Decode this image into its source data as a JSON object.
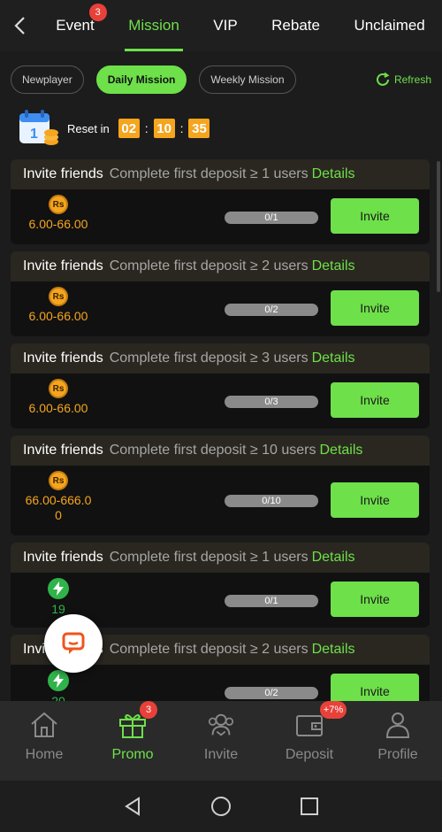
{
  "topnav": {
    "tabs": [
      {
        "label": "Event",
        "badge": "3"
      },
      {
        "label": "Mission"
      },
      {
        "label": "VIP"
      },
      {
        "label": "Rebate"
      },
      {
        "label": "Unclaimed"
      }
    ],
    "active": "Mission"
  },
  "filters": {
    "items": [
      "Newplayer",
      "Daily Mission",
      "Weekly Mission"
    ],
    "active": "Daily Mission",
    "refresh_label": "Refresh"
  },
  "reset": {
    "label": "Reset in",
    "hours": "02",
    "minutes": "10",
    "seconds": "35",
    "sep": ":"
  },
  "tasks": [
    {
      "title": "Invite friends",
      "desc": "Complete first deposit ≥ 1 users",
      "details": "Details",
      "reward_icon": "rs-coin-icon",
      "coin_text": "Rs",
      "amount": "6.00-66.00",
      "progress": "0/1",
      "button": "Invite"
    },
    {
      "title": "Invite friends",
      "desc": "Complete first deposit ≥ 2 users",
      "details": "Details",
      "reward_icon": "rs-coin-icon",
      "coin_text": "Rs",
      "amount": "6.00-66.00",
      "progress": "0/2",
      "button": "Invite"
    },
    {
      "title": "Invite friends",
      "desc": "Complete first deposit ≥ 3 users",
      "details": "Details",
      "reward_icon": "rs-coin-icon",
      "coin_text": "Rs",
      "amount": "6.00-66.00",
      "progress": "0/3",
      "button": "Invite"
    },
    {
      "title": "Invite friends",
      "desc": "Complete first deposit ≥ 10 users",
      "details": "Details",
      "reward_icon": "rs-coin-icon",
      "coin_text": "Rs",
      "amount": "66.00-666.0",
      "amount2": "0",
      "progress": "0/10",
      "button": "Invite"
    },
    {
      "title": "Invite friends",
      "desc": "Complete first deposit ≥ 1 users",
      "details": "Details",
      "reward_icon": "bolt-icon",
      "amount": "19",
      "progress": "0/1",
      "button": "Invite"
    },
    {
      "title": "Invite friends",
      "desc": "Complete first deposit ≥ 2 users",
      "details": "Details",
      "reward_icon": "bolt-icon",
      "amount": "20",
      "progress": "0/2",
      "button": "Invite"
    }
  ],
  "bottomnav": {
    "items": [
      {
        "label": "Home",
        "icon": "home-icon"
      },
      {
        "label": "Promo",
        "icon": "gift-icon",
        "badge": "3"
      },
      {
        "label": "Invite",
        "icon": "users-icon"
      },
      {
        "label": "Deposit",
        "icon": "wallet-icon",
        "badge": "+7%"
      },
      {
        "label": "Profile",
        "icon": "profile-icon"
      }
    ],
    "active": "Promo"
  },
  "colors": {
    "accent": "#6ee04a",
    "orange": "#f5a51e",
    "badge": "#e8413a",
    "bg": "#1c1c1c"
  }
}
